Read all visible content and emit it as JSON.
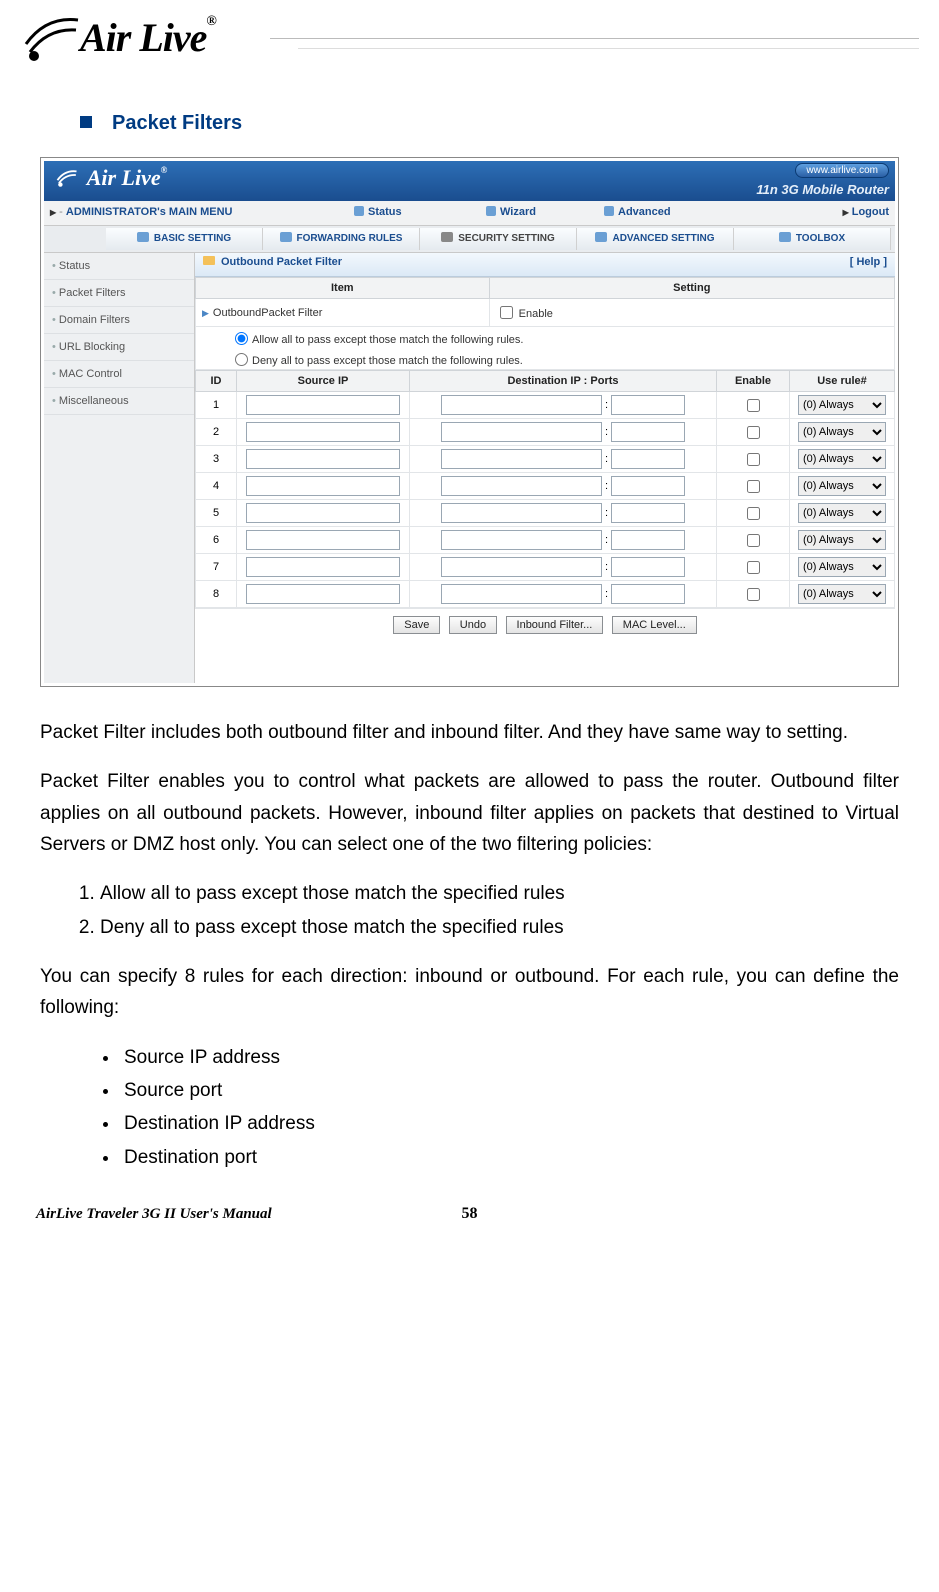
{
  "header": {
    "brand": "Air Live",
    "registered": "®"
  },
  "section_title": "Packet Filters",
  "shot": {
    "router_brand": "Air Live",
    "router_reg": "®",
    "url_pill": "www.airlive.com",
    "router_title": "11n 3G Mobile Router",
    "menubar": {
      "admin": "ADMINISTRATOR's MAIN MENU",
      "status": "Status",
      "wizard": "Wizard",
      "advanced": "Advanced",
      "logout": "Logout"
    },
    "tabs": {
      "t0": "BASIC SETTING",
      "t1": "FORWARDING RULES",
      "t2": "SECURITY SETTING",
      "t3": "ADVANCED SETTING",
      "t4": "TOOLBOX"
    },
    "sidebar": {
      "s0": "Status",
      "s1": "Packet Filters",
      "s2": "Domain Filters",
      "s3": "URL Blocking",
      "s4": "MAC Control",
      "s5": "Miscellaneous"
    },
    "panel_title": "Outbound Packet Filter",
    "help": "[ Help ]",
    "item_header": "Item",
    "setting_header": "Setting",
    "item_label": "OutboundPacket Filter",
    "enable_label": "Enable",
    "policy_allow": "Allow all to pass except those match the following rules.",
    "policy_deny": "Deny all to pass except those match the following rules.",
    "cols": {
      "id": "ID",
      "src": "Source IP",
      "dst": "Destination IP : Ports",
      "en": "Enable",
      "use": "Use rule#"
    },
    "rule_option": "(0) Always",
    "ids": {
      "r1": "1",
      "r2": "2",
      "r3": "3",
      "r4": "4",
      "r5": "5",
      "r6": "6",
      "r7": "7",
      "r8": "8"
    },
    "buttons": {
      "save": "Save",
      "undo": "Undo",
      "inbound": "Inbound Filter...",
      "mac": "MAC Level..."
    }
  },
  "doc": {
    "p1": "Packet Filter includes both outbound filter and inbound filter. And they have same way to setting.",
    "p2": "Packet Filter enables you to control what packets are allowed to pass the router. Outbound filter applies on all outbound packets. However, inbound filter applies on packets that destined to Virtual Servers or DMZ host only. You can select one of the two filtering policies:",
    "n1": "Allow all to pass except those match the specified rules",
    "n2": "Deny all to pass except those match the specified rules",
    "p3": "You can specify 8 rules for each direction: inbound or outbound. For each rule, you can define the following:",
    "b1": "Source IP address",
    "b2": "Source port",
    "b3": "Destination IP address",
    "b4": "Destination port"
  },
  "footer": {
    "title": "AirLive Traveler 3G II User's Manual",
    "page": "58"
  }
}
